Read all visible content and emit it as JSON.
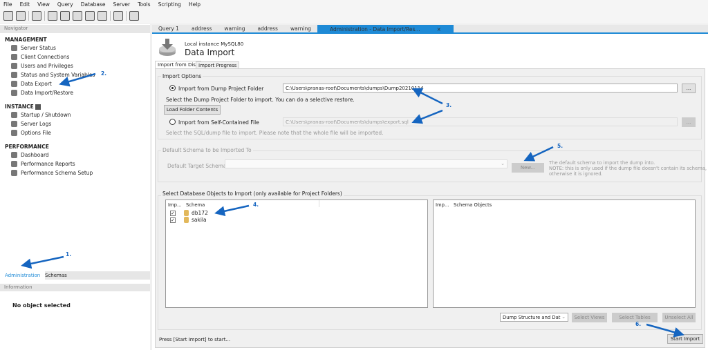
{
  "menu": [
    "File",
    "Edit",
    "View",
    "Query",
    "Database",
    "Server",
    "Tools",
    "Scripting",
    "Help"
  ],
  "navigator": {
    "title": "Navigator",
    "management": {
      "title": "MANAGEMENT",
      "items": [
        "Server Status",
        "Client Connections",
        "Users and Privileges",
        "Status and System Variables",
        "Data Export",
        "Data Import/Restore"
      ]
    },
    "instance": {
      "title": "INSTANCE",
      "items": [
        "Startup / Shutdown",
        "Server Logs",
        "Options File"
      ]
    },
    "performance": {
      "title": "PERFORMANCE",
      "items": [
        "Dashboard",
        "Performance Reports",
        "Performance Schema Setup"
      ]
    },
    "bottom_tabs": [
      "Administration",
      "Schemas"
    ],
    "info_title": "Information",
    "info_text": "No object selected"
  },
  "query_tabs": [
    "Query 1",
    "address",
    "warning",
    "address",
    "warning",
    "Administration - Data Import/Res..."
  ],
  "header": {
    "subtitle": "Local instance MySQL80",
    "title": "Data Import"
  },
  "sub_tabs": [
    "Import from Disk",
    "Import Progress"
  ],
  "import_options": {
    "title": "Import Options",
    "radio1": "Import from Dump Project Folder",
    "path1": "C:\\Users\\pranas-root\\Documents\\dumps\\Dump20210114",
    "hint1": "Select the Dump Project Folder to import. You can do a selective restore.",
    "load_button": "Load Folder Contents",
    "radio2": "Import from Self-Contained File",
    "path2": "C:\\Users\\pranas-root\\Documents\\dumps\\export.sql",
    "hint2": "Select the SQL/dump file to import. Please note that the whole file will be imported.",
    "browse": "..."
  },
  "default_schema": {
    "title": "Default Schema to be Imported To",
    "label": "Default Target Schema:",
    "new_button": "New...",
    "note1": "The default schema to import the dump into.",
    "note2": "NOTE: this is only used if the dump file doesn't contain its schema,",
    "note3": "otherwise it is ignored."
  },
  "objects": {
    "title": "Select Database Objects to Import (only available for Project Folders)",
    "left_cols": [
      "Imp...",
      "Schema"
    ],
    "schemas": [
      "db172",
      "sakila"
    ],
    "right_cols": [
      "Imp...",
      "Schema Objects"
    ],
    "dump_select": "Dump Structure and Dat",
    "select_views": "Select Views",
    "select_tables": "Select Tables",
    "unselect_all": "Unselect All"
  },
  "status": "Press [Start Import] to start...",
  "start_button": "Start Import",
  "annotations": [
    "1.",
    "2.",
    "3.",
    "4.",
    "5.",
    "6."
  ],
  "colors": {
    "accent": "#1e8ad6",
    "annotation": "#1565c0"
  }
}
